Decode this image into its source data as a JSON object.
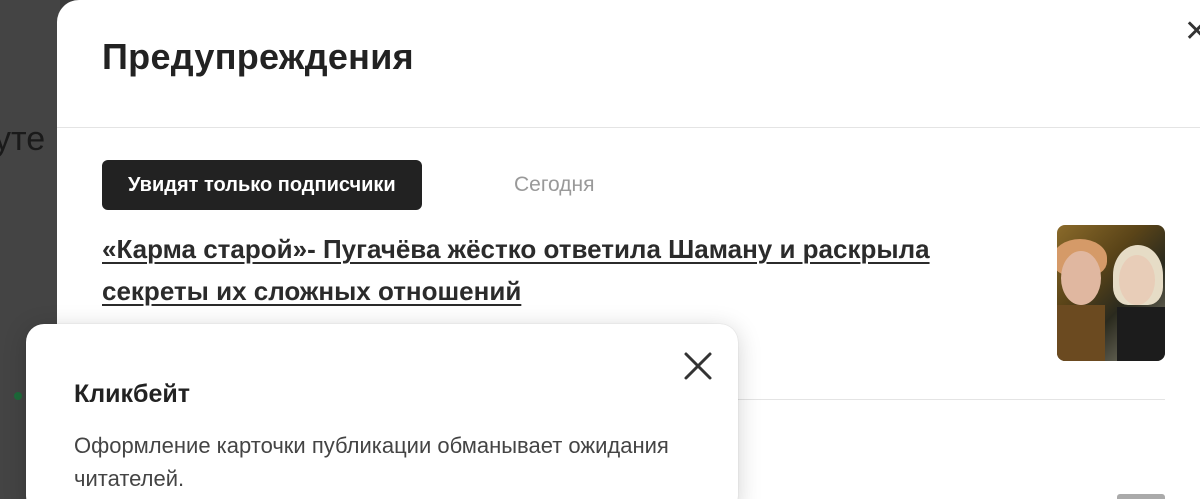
{
  "background": {
    "fragment_text": "уте"
  },
  "modal": {
    "title": "Предупреждения",
    "close_icon": "close-icon"
  },
  "warning_item": {
    "badge": "Увидят только подписчики",
    "date": "Сегодня",
    "article_title": "«Карма старой»- Пугачёва жёстко ответила Шаману и раскрыла секреты их сложных отношений",
    "thumbnail_icon": "article-thumbnail"
  },
  "popover": {
    "close_icon": "close-icon",
    "title": "Кликбейт",
    "description": "Оформление карточки публикации обманывает ожидания читателей."
  },
  "colors": {
    "badge_bg": "#222222",
    "overlay_bg": "#3a3a3a",
    "text_muted": "#999999"
  }
}
